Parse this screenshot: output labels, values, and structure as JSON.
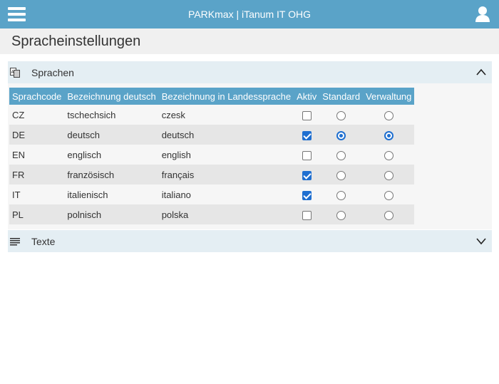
{
  "app": {
    "title": "PARKmax | iTanum IT OHG"
  },
  "page": {
    "title": "Spracheinstellungen"
  },
  "panels": {
    "languages": {
      "label": "Sprachen",
      "icon": "translate-icon",
      "expanded": true
    },
    "texts": {
      "label": "Texte",
      "icon": "text-lines-icon",
      "expanded": false
    }
  },
  "table": {
    "headers": [
      "Sprachcode",
      "Bezeichnung deutsch",
      "Bezeichnung in Landessprache",
      "Aktiv",
      "Standard",
      "Verwaltung"
    ],
    "rows": [
      {
        "code": "CZ",
        "name_de": "tschechsich",
        "name_local": "czesk",
        "active": false,
        "standard": false,
        "admin": false
      },
      {
        "code": "DE",
        "name_de": "deutsch",
        "name_local": "deutsch",
        "active": true,
        "standard": true,
        "admin": true
      },
      {
        "code": "EN",
        "name_de": "englisch",
        "name_local": "english",
        "active": false,
        "standard": false,
        "admin": false
      },
      {
        "code": "FR",
        "name_de": "französisch",
        "name_local": "français",
        "active": true,
        "standard": false,
        "admin": false
      },
      {
        "code": "IT",
        "name_de": "italienisch",
        "name_local": "italiano",
        "active": true,
        "standard": false,
        "admin": false
      },
      {
        "code": "PL",
        "name_de": "polnisch",
        "name_local": "polska",
        "active": false,
        "standard": false,
        "admin": false
      }
    ]
  },
  "colors": {
    "accent": "#5aa3c8",
    "control": "#1f6fd0"
  }
}
